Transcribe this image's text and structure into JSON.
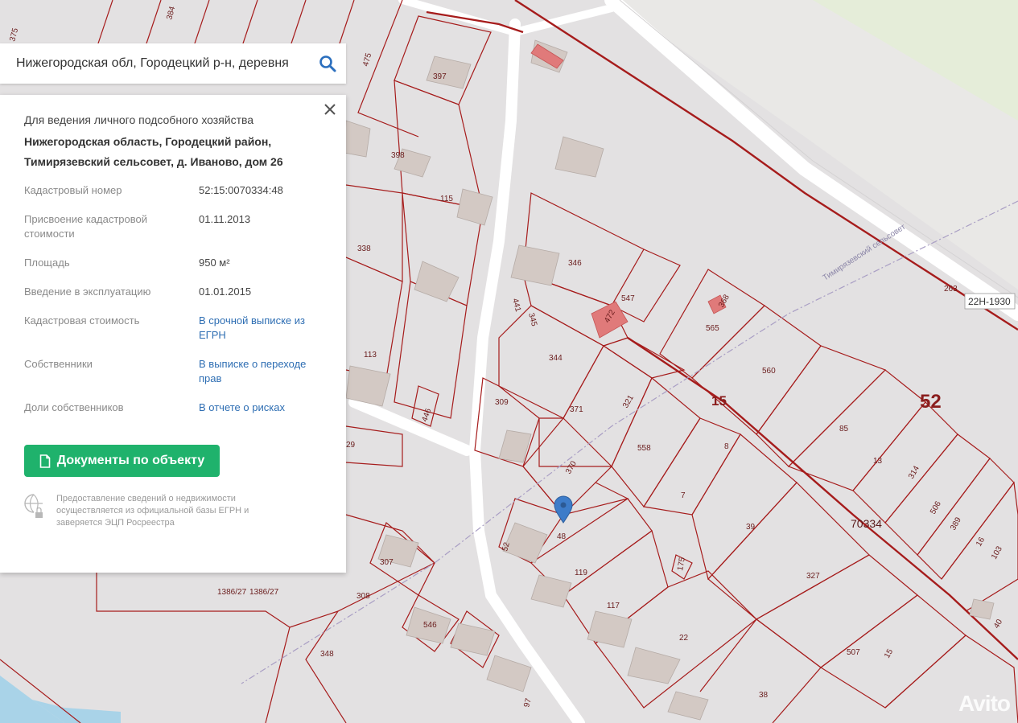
{
  "search": {
    "text": "Нижегородская обл, Городецкий р-н, деревня"
  },
  "card": {
    "purpose": "Для ведения личного подсобного хозяйства",
    "address": "Нижегородская область, Городецкий район, Тимирязевский сельсовет, д. Иваново, дом 26",
    "rows": [
      {
        "label": "Кадастровый номер",
        "value": "52:15:0070334:48"
      },
      {
        "label": "Присвоение кадастровой стоимости",
        "value": "01.11.2013"
      },
      {
        "label": "Площадь",
        "value": "950 м²"
      },
      {
        "label": "Введение в эксплуатацию",
        "value": "01.01.2015"
      },
      {
        "label": "Кадастровая стоимость",
        "value": "В срочной выписке из ЕГРН"
      },
      {
        "label": "Собственники",
        "value": "В выписке о переходе прав"
      },
      {
        "label": "Доли собственников",
        "value": "В отчете о рисках"
      }
    ],
    "docs_button": "Документы по объекту",
    "notice": "Предоставление сведений о недвижимости осуществляется из официальной базы ЕГРН и заверяется ЭЦП Росреестра"
  },
  "map": {
    "region_number": "52",
    "district_number": "15",
    "block_number": "70334",
    "road_code": "22Н-1930",
    "boundary_label": "Тимирязевский сельсовет",
    "selected_parcel": "48",
    "parcel_labels": [
      "397",
      "398",
      "115",
      "338",
      "113",
      "446",
      "29",
      "346",
      "441",
      "345",
      "344",
      "309",
      "371",
      "321",
      "547",
      "472",
      "565",
      "368",
      "560",
      "85",
      "13",
      "314",
      "506",
      "389",
      "16",
      "103",
      "558",
      "8",
      "7",
      "39",
      "370",
      "119",
      "117",
      "22",
      "327",
      "507",
      "15",
      "38",
      "40",
      "308",
      "307",
      "546",
      "348",
      "1386/27",
      "1386/27",
      "175",
      "263",
      "475",
      "384",
      "375",
      "97",
      "52"
    ],
    "watermark": "Avito"
  },
  "colors": {
    "parcel_line": "#a61c1c",
    "accent_green": "#1fb26c",
    "link": "#2e6eb3",
    "pin": "#3d7cc9"
  }
}
